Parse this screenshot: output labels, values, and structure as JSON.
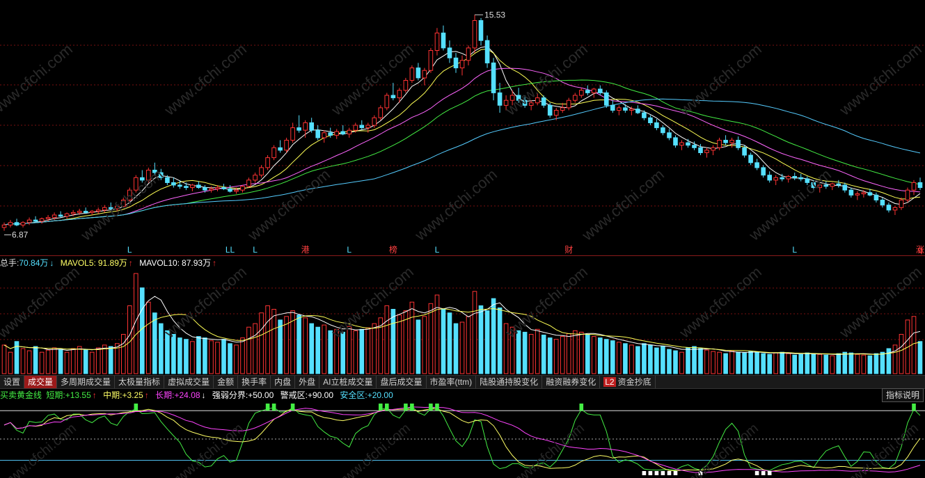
{
  "price_panel": {
    "high_label": "15.53",
    "low_label": "6.87",
    "markers": [
      {
        "text": "L",
        "color": "#55e0ff"
      },
      {
        "text": "LL",
        "color": "#55e0ff"
      },
      {
        "text": "L",
        "color": "#55e0ff"
      },
      {
        "text": "港",
        "color": "#ff4040"
      },
      {
        "text": "L",
        "color": "#55e0ff"
      },
      {
        "text": "榜",
        "color": "#ff4040"
      },
      {
        "text": "L",
        "color": "#55e0ff"
      },
      {
        "text": "财",
        "color": "#ff4040"
      },
      {
        "text": "L",
        "color": "#55e0ff"
      },
      {
        "text": "q",
        "color": "#ff4040"
      },
      {
        "text": "涨",
        "color": "#ff4040"
      }
    ]
  },
  "volume_legend": {
    "vol_label": "总手:",
    "vol_value": "70.84万",
    "vol_arrow": "↓",
    "mavol5_label": "MAVOL5:",
    "mavol5_value": "91.89万",
    "mavol5_arrow": "↑",
    "mavol10_label": "MAVOL10:",
    "mavol10_value": "87.93万",
    "mavol10_arrow": "↑"
  },
  "tabs": [
    {
      "label": "设置",
      "active": false
    },
    {
      "label": "成交量",
      "active": true
    },
    {
      "label": "多周期成交量",
      "active": false
    },
    {
      "label": "太极量指标",
      "active": false
    },
    {
      "label": "虚拟成交量",
      "active": false
    },
    {
      "label": "金额",
      "active": false
    },
    {
      "label": "换手率",
      "active": false
    },
    {
      "label": "内盘",
      "active": false
    },
    {
      "label": "外盘",
      "active": false
    },
    {
      "label": "AI立桩成交量",
      "active": false
    },
    {
      "label": "盘后成交量",
      "active": false
    },
    {
      "label": "市盈率(ttm)",
      "active": false
    },
    {
      "label": "陆股通持股变化",
      "active": false
    },
    {
      "label": "融资融券变化",
      "active": false
    },
    {
      "label": "资金抄底",
      "badge": "L2",
      "active": false
    }
  ],
  "indicator_legend": {
    "name": "买卖黄金线",
    "short_label": "短期:",
    "short_value": "+13.55",
    "short_arrow": "↑",
    "mid_label": "中期:",
    "mid_value": "+3.25",
    "mid_arrow": "↑",
    "long_label": "长期:",
    "long_value": "+24.08",
    "long_arrow": "↓",
    "strong_label": "强弱分界:",
    "strong_value": "+50.00",
    "warn_label": "警戒区:",
    "warn_value": "+90.00",
    "safe_label": "安全区:",
    "safe_value": "+20.00"
  },
  "help_button": "指标说明",
  "watermark": "www.cfchi.com",
  "colors": {
    "up": "#ff3333",
    "down": "#55e0ff",
    "ma5": "#ffffff",
    "ma10": "#ffff55",
    "ma20": "#ff66ff",
    "ma30": "#44ee44",
    "ma60": "#55ccff",
    "short": "#44ee44",
    "mid": "#ffff66",
    "long": "#ff44ff"
  },
  "chart_data": {
    "type": "candlestick",
    "price_extremes": {
      "high": 15.53,
      "low": 6.87
    },
    "ohlc": [
      [
        7.0,
        7.2,
        6.87,
        7.1
      ],
      [
        7.1,
        7.3,
        7.0,
        7.2
      ],
      [
        7.2,
        7.35,
        7.05,
        7.1
      ],
      [
        7.1,
        7.25,
        7.0,
        7.2
      ],
      [
        7.2,
        7.4,
        7.1,
        7.3
      ],
      [
        7.3,
        7.45,
        7.2,
        7.25
      ],
      [
        7.25,
        7.4,
        7.15,
        7.35
      ],
      [
        7.35,
        7.5,
        7.25,
        7.4
      ],
      [
        7.4,
        7.6,
        7.3,
        7.5
      ],
      [
        7.5,
        7.65,
        7.4,
        7.45
      ],
      [
        7.45,
        7.6,
        7.35,
        7.55
      ],
      [
        7.55,
        7.7,
        7.45,
        7.6
      ],
      [
        7.6,
        7.75,
        7.5,
        7.65
      ],
      [
        7.65,
        7.8,
        7.55,
        7.6
      ],
      [
        7.6,
        7.7,
        7.5,
        7.65
      ],
      [
        7.65,
        7.8,
        7.55,
        7.7
      ],
      [
        7.7,
        7.9,
        7.6,
        7.8
      ],
      [
        7.8,
        8.0,
        7.7,
        7.75
      ],
      [
        7.75,
        7.9,
        7.65,
        7.85
      ],
      [
        7.85,
        8.2,
        7.8,
        8.1
      ],
      [
        8.1,
        8.6,
        8.0,
        8.5
      ],
      [
        8.5,
        9.1,
        8.4,
        9.0
      ],
      [
        9.0,
        9.3,
        8.8,
        8.9
      ],
      [
        8.9,
        9.4,
        8.8,
        9.3
      ],
      [
        9.3,
        9.6,
        9.1,
        9.2
      ],
      [
        9.2,
        9.35,
        8.9,
        9.0
      ],
      [
        9.0,
        9.1,
        8.7,
        8.8
      ],
      [
        8.8,
        9.0,
        8.6,
        8.7
      ],
      [
        8.7,
        8.9,
        8.55,
        8.65
      ],
      [
        8.65,
        8.8,
        8.5,
        8.6
      ],
      [
        8.6,
        8.75,
        8.45,
        8.7
      ],
      [
        8.7,
        8.85,
        8.55,
        8.6
      ],
      [
        8.6,
        8.7,
        8.4,
        8.5
      ],
      [
        8.5,
        8.65,
        8.4,
        8.55
      ],
      [
        8.55,
        8.7,
        8.45,
        8.6
      ],
      [
        8.6,
        8.75,
        8.5,
        8.55
      ],
      [
        8.55,
        8.7,
        8.4,
        8.45
      ],
      [
        8.45,
        8.6,
        8.35,
        8.5
      ],
      [
        8.5,
        8.7,
        8.4,
        8.65
      ],
      [
        8.65,
        9.0,
        8.6,
        8.9
      ],
      [
        8.9,
        9.2,
        8.8,
        9.1
      ],
      [
        9.1,
        9.5,
        9.0,
        9.4
      ],
      [
        9.4,
        9.9,
        9.3,
        9.8
      ],
      [
        9.8,
        10.3,
        9.7,
        10.2
      ],
      [
        10.2,
        10.5,
        10.0,
        10.1
      ],
      [
        10.1,
        10.6,
        10.0,
        10.5
      ],
      [
        10.5,
        11.2,
        10.4,
        11.0
      ],
      [
        11.0,
        11.5,
        10.8,
        10.9
      ],
      [
        10.9,
        11.3,
        10.6,
        11.2
      ],
      [
        11.2,
        11.4,
        10.8,
        10.9
      ],
      [
        10.9,
        11.1,
        10.5,
        10.6
      ],
      [
        10.6,
        10.9,
        10.4,
        10.8
      ],
      [
        10.8,
        11.0,
        10.6,
        10.7
      ],
      [
        10.7,
        10.95,
        10.55,
        10.85
      ],
      [
        10.85,
        11.1,
        10.7,
        10.75
      ],
      [
        10.75,
        11.0,
        10.6,
        10.9
      ],
      [
        10.9,
        11.2,
        10.8,
        11.1
      ],
      [
        11.1,
        11.3,
        10.9,
        11.0
      ],
      [
        11.0,
        11.2,
        10.8,
        11.1
      ],
      [
        11.1,
        11.5,
        11.0,
        11.4
      ],
      [
        11.4,
        11.9,
        11.3,
        11.8
      ],
      [
        11.8,
        12.4,
        11.7,
        12.3
      ],
      [
        12.3,
        12.8,
        12.1,
        12.2
      ],
      [
        12.2,
        12.6,
        12.0,
        12.5
      ],
      [
        12.5,
        13.0,
        12.4,
        12.9
      ],
      [
        12.9,
        13.5,
        12.8,
        13.4
      ],
      [
        13.4,
        13.6,
        12.9,
        13.0
      ],
      [
        13.0,
        13.4,
        12.7,
        13.3
      ],
      [
        13.3,
        14.2,
        13.2,
        14.1
      ],
      [
        14.1,
        15.0,
        13.9,
        14.8
      ],
      [
        14.8,
        15.1,
        14.1,
        14.2
      ],
      [
        14.2,
        14.5,
        13.6,
        13.8
      ],
      [
        13.8,
        14.0,
        13.2,
        13.4
      ],
      [
        13.4,
        13.9,
        13.1,
        13.7
      ],
      [
        13.7,
        14.3,
        13.5,
        14.2
      ],
      [
        14.2,
        15.53,
        14.0,
        15.3
      ],
      [
        15.3,
        15.4,
        14.3,
        14.5
      ],
      [
        14.5,
        14.7,
        13.4,
        13.6
      ],
      [
        13.6,
        13.8,
        12.1,
        12.4
      ],
      [
        12.4,
        12.8,
        11.6,
        11.9
      ],
      [
        11.9,
        12.3,
        11.7,
        12.1
      ],
      [
        12.1,
        12.5,
        11.9,
        12.3
      ],
      [
        12.3,
        12.6,
        12.0,
        12.1
      ],
      [
        12.1,
        12.3,
        11.8,
        11.9
      ],
      [
        11.9,
        12.1,
        11.7,
        12.0
      ],
      [
        12.0,
        12.4,
        11.9,
        12.2
      ],
      [
        12.2,
        12.3,
        11.8,
        11.9
      ],
      [
        11.9,
        12.0,
        11.4,
        11.5
      ],
      [
        11.5,
        11.8,
        11.3,
        11.7
      ],
      [
        11.7,
        12.0,
        11.6,
        11.8
      ],
      [
        11.8,
        12.2,
        11.7,
        12.1
      ],
      [
        12.1,
        12.4,
        12.0,
        12.3
      ],
      [
        12.3,
        12.6,
        12.2,
        12.5
      ],
      [
        12.5,
        12.7,
        12.3,
        12.4
      ],
      [
        12.4,
        12.6,
        12.2,
        12.55
      ],
      [
        12.55,
        12.7,
        12.3,
        12.4
      ],
      [
        12.4,
        12.5,
        11.8,
        11.9
      ],
      [
        11.9,
        12.1,
        11.6,
        11.7
      ],
      [
        11.7,
        11.9,
        11.5,
        11.8
      ],
      [
        11.8,
        11.95,
        11.6,
        11.7
      ],
      [
        11.7,
        11.85,
        11.5,
        11.75
      ],
      [
        11.75,
        11.9,
        11.55,
        11.6
      ],
      [
        11.6,
        11.7,
        11.3,
        11.4
      ],
      [
        11.4,
        11.5,
        11.1,
        11.2
      ],
      [
        11.2,
        11.35,
        10.9,
        11.0
      ],
      [
        11.0,
        11.1,
        10.7,
        10.8
      ],
      [
        10.8,
        10.95,
        10.5,
        10.6
      ],
      [
        10.6,
        10.7,
        10.2,
        10.3
      ],
      [
        10.3,
        10.5,
        10.1,
        10.4
      ],
      [
        10.4,
        10.55,
        10.2,
        10.3
      ],
      [
        10.3,
        10.45,
        10.1,
        10.2
      ],
      [
        10.2,
        10.35,
        9.9,
        10.0
      ],
      [
        10.0,
        10.2,
        9.8,
        10.1
      ],
      [
        10.1,
        10.3,
        9.9,
        10.2
      ],
      [
        10.2,
        10.6,
        10.1,
        10.5
      ],
      [
        10.5,
        10.7,
        10.3,
        10.4
      ],
      [
        10.4,
        10.6,
        10.2,
        10.5
      ],
      [
        10.5,
        10.65,
        10.1,
        10.2
      ],
      [
        10.2,
        10.3,
        9.8,
        9.9
      ],
      [
        9.9,
        10.0,
        9.5,
        9.6
      ],
      [
        9.6,
        9.75,
        9.3,
        9.4
      ],
      [
        9.4,
        9.5,
        9.0,
        9.1
      ],
      [
        9.1,
        9.25,
        8.8,
        8.9
      ],
      [
        8.9,
        9.1,
        8.7,
        9.0
      ],
      [
        9.0,
        9.15,
        8.85,
        8.95
      ],
      [
        8.95,
        9.1,
        8.8,
        9.05
      ],
      [
        9.05,
        9.2,
        8.9,
        9.0
      ],
      [
        9.0,
        9.15,
        8.85,
        8.95
      ],
      [
        8.95,
        9.05,
        8.7,
        8.8
      ],
      [
        8.8,
        8.9,
        8.5,
        8.6
      ],
      [
        8.6,
        8.75,
        8.4,
        8.7
      ],
      [
        8.7,
        8.85,
        8.55,
        8.65
      ],
      [
        8.65,
        8.8,
        8.5,
        8.75
      ],
      [
        8.75,
        8.9,
        8.6,
        8.7
      ],
      [
        8.7,
        8.8,
        8.4,
        8.5
      ],
      [
        8.5,
        8.6,
        8.2,
        8.3
      ],
      [
        8.3,
        8.45,
        8.1,
        8.35
      ],
      [
        8.35,
        8.5,
        8.2,
        8.4
      ],
      [
        8.4,
        8.55,
        8.25,
        8.3
      ],
      [
        8.3,
        8.4,
        8.0,
        8.1
      ],
      [
        8.1,
        8.2,
        7.8,
        7.9
      ],
      [
        7.9,
        8.0,
        7.6,
        7.7
      ],
      [
        7.7,
        7.85,
        7.5,
        7.8
      ],
      [
        7.8,
        8.2,
        7.7,
        8.1
      ],
      [
        8.1,
        8.6,
        8.0,
        8.5
      ],
      [
        8.5,
        8.9,
        8.3,
        8.8
      ],
      [
        8.8,
        9.0,
        8.5,
        8.6
      ]
    ],
    "volume": [
      40,
      30,
      45,
      35,
      32,
      38,
      30,
      33,
      36,
      34,
      30,
      35,
      38,
      34,
      30,
      36,
      40,
      38,
      42,
      55,
      95,
      140,
      120,
      100,
      85,
      70,
      60,
      55,
      50,
      48,
      45,
      52,
      50,
      46,
      44,
      48,
      42,
      40,
      50,
      65,
      70,
      85,
      95,
      90,
      75,
      80,
      88,
      82,
      78,
      70,
      65,
      68,
      60,
      62,
      58,
      66,
      60,
      62,
      64,
      70,
      78,
      95,
      90,
      82,
      88,
      100,
      75,
      80,
      98,
      110,
      90,
      85,
      70,
      72,
      80,
      115,
      95,
      88,
      105,
      92,
      70,
      65,
      60,
      58,
      55,
      62,
      54,
      50,
      48,
      52,
      56,
      60,
      58,
      55,
      52,
      50,
      48,
      46,
      44,
      42,
      40,
      38,
      42,
      40,
      36,
      38,
      34,
      32,
      30,
      36,
      38,
      35,
      33,
      31,
      30,
      28,
      32,
      30,
      29,
      31,
      30,
      28,
      27,
      29,
      30,
      28,
      26,
      27,
      29,
      28,
      27,
      26,
      25,
      28,
      30,
      29,
      27,
      26,
      25,
      28,
      30,
      35,
      40,
      55,
      75,
      80,
      45
    ],
    "indicator": {
      "levels": {
        "strong_weak": 50,
        "warning": 90,
        "safe": 20
      },
      "short_latest": 13.55,
      "mid_latest": 3.25,
      "long_latest": 24.08
    }
  }
}
